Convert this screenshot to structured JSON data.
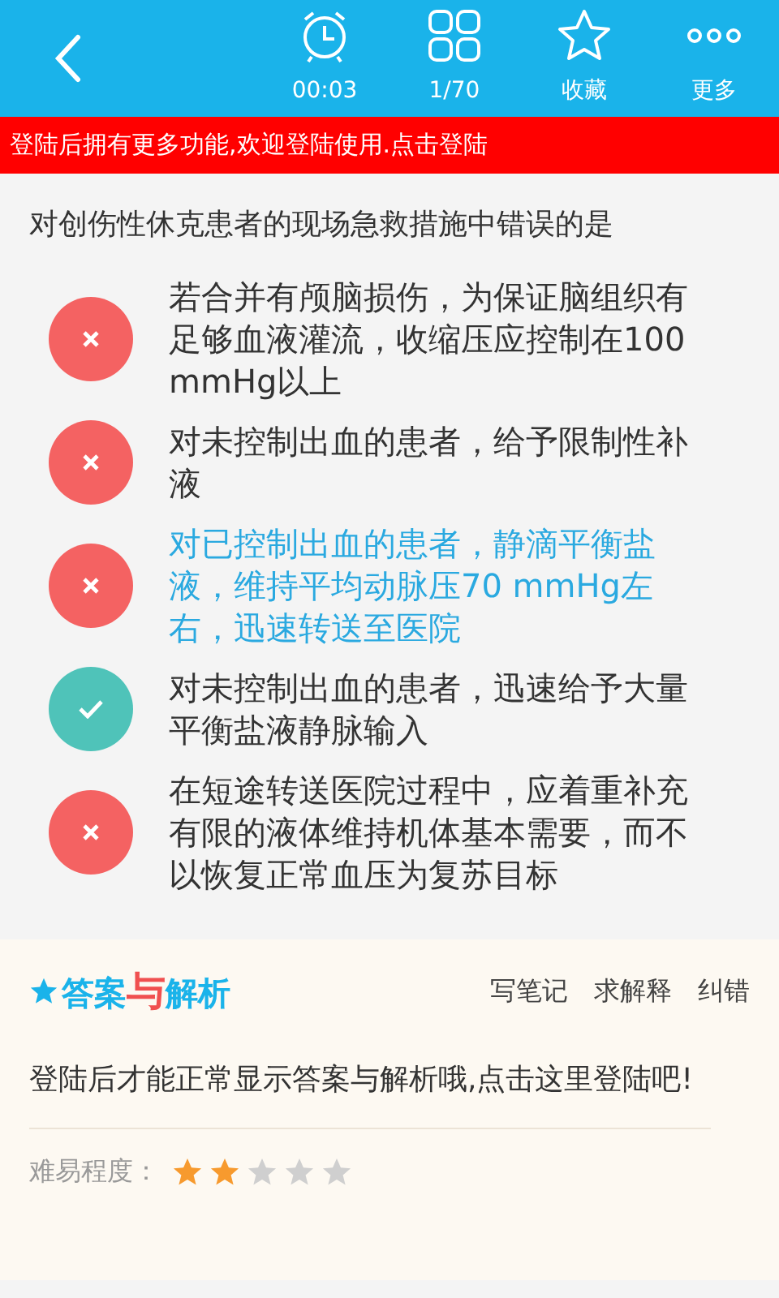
{
  "toolbar": {
    "items": [
      {
        "kind": "timer",
        "label": "00:03"
      },
      {
        "kind": "grid",
        "label": "1/70"
      },
      {
        "kind": "star",
        "label": "收藏"
      },
      {
        "kind": "more",
        "label": "更多"
      }
    ]
  },
  "login_banner": "登陆后拥有更多功能,欢迎登陆使用.点击登陆",
  "question": "对创伤性休克患者的现场急救措施中错误的是",
  "options": [
    {
      "text": "若合并有颅脑损伤，为保证脑组织有足够血液灌流，收缩压应控制在100 mmHg以上",
      "kind": "wrong",
      "selected": false
    },
    {
      "text": "对未控制出血的患者，给予限制性补液",
      "kind": "wrong",
      "selected": false
    },
    {
      "text": "对已控制出血的患者，静滴平衡盐液，维持平均动脉压70 mmHg左右，迅速转送至医院",
      "kind": "wrong",
      "selected": true
    },
    {
      "text": "对未控制出血的患者，迅速给予大量平衡盐液静脉输入",
      "kind": "correct",
      "selected": false
    },
    {
      "text": "在短途转送医院过程中，应着重补充有限的液体维持机体基本需要，而不以恢复正常血压为复苏目标",
      "kind": "wrong",
      "selected": false
    }
  ],
  "answer_panel": {
    "title": [
      {
        "text": "答案",
        "accent": false
      },
      {
        "text": "与",
        "accent": true
      },
      {
        "text": "解析",
        "accent": false
      }
    ],
    "actions": [
      "写笔记",
      "求解释",
      "纠错"
    ],
    "message": "登陆后才能正常显示答案与解析哦,点击这里登陆吧!",
    "difficulty_label": "难易程度：",
    "stars": 2
  }
}
